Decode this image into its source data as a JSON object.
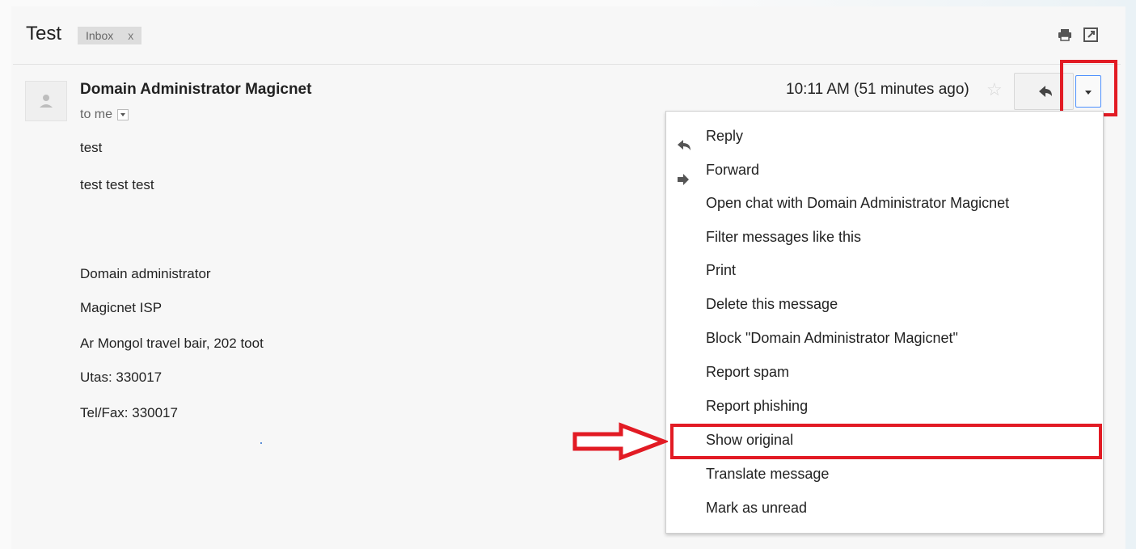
{
  "thread": {
    "subject": "Test",
    "label": "Inbox",
    "label_remove": "x",
    "icons": [
      "print-icon",
      "new-window-icon"
    ]
  },
  "message": {
    "sender": "Domain Administrator Magicnet",
    "recipient_line": "to me",
    "timestamp": "10:11 AM (51 minutes ago)",
    "body": [
      "test",
      "test test test",
      "Domain administrator",
      "Magicnet ISP",
      "Ar Mongol travel bair, 202 toot",
      "Utas: 330017",
      "Tel/Fax: 330017"
    ]
  },
  "menu": {
    "items": [
      {
        "label": "Reply",
        "icon": "reply-icon"
      },
      {
        "label": "Forward",
        "icon": "forward-icon"
      },
      {
        "label": "Open chat with Domain Administrator Magicnet"
      },
      {
        "label": "Filter messages like this"
      },
      {
        "label": "Print"
      },
      {
        "label": "Delete this message"
      },
      {
        "label": "Block \"Domain Administrator Magicnet\""
      },
      {
        "label": "Report spam"
      },
      {
        "label": "Report phishing"
      },
      {
        "label": "Show original",
        "highlighted": true
      },
      {
        "label": "Translate message"
      },
      {
        "label": "Mark as unread"
      }
    ]
  },
  "annotations": {
    "highlight_color": "#e21b24",
    "highlighted_control": "more-options-button",
    "highlighted_menu_item": "Show original"
  },
  "colors": {
    "accent_focus": "#4d90fe",
    "star_inactive": "#d6d6d6"
  }
}
